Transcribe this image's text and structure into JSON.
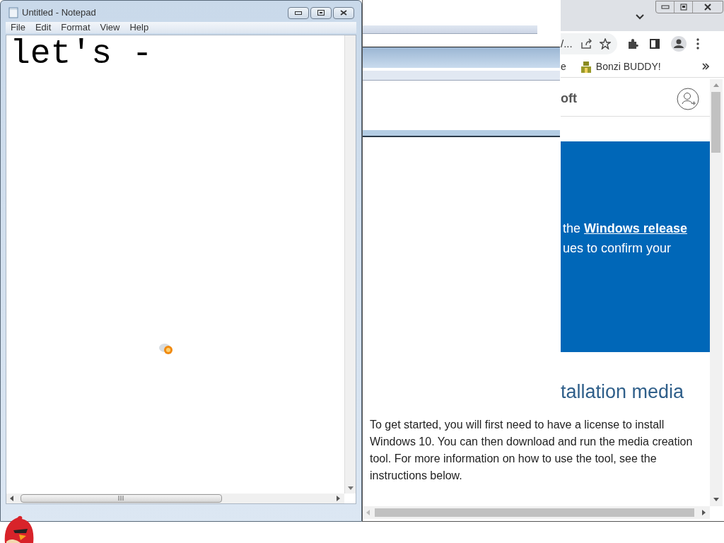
{
  "notepad": {
    "title": "Untitled - Notepad",
    "menu": [
      "File",
      "Edit",
      "Format",
      "View",
      "Help"
    ],
    "text": "let's -"
  },
  "browser": {
    "address_fragment": "/...",
    "bookmarks": [
      {
        "label": "e",
        "kind": "text"
      },
      {
        "label": "Bonzi BUDDY!",
        "kind": "folder"
      }
    ],
    "header_fragment": "oft",
    "hero": {
      "line_1": {
        "text": "the",
        "link": "Windows release"
      },
      "line_2": "ues to confirm your"
    },
    "section_heading": "tallation media",
    "paragraph": "To get started, you will first need to have a license to install Windows 10. You can then download and run the media creation tool. For more information on how to use the tool, see the instructions below."
  }
}
